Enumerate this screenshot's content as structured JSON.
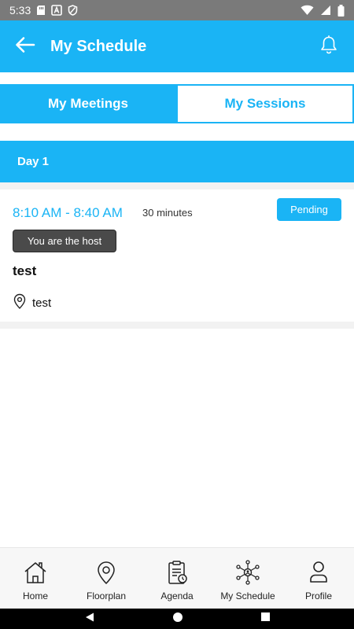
{
  "status_bar": {
    "time": "5:33",
    "icons_left": [
      "sd-card-icon",
      "a-icon",
      "shield-icon"
    ],
    "icons_right": [
      "wifi-icon",
      "signal-icon",
      "battery-icon"
    ]
  },
  "app_bar": {
    "title": "My Schedule",
    "back_icon": "arrow-left-icon",
    "notification_icon": "bell-icon"
  },
  "tabs": [
    {
      "label": "My Meetings",
      "active": true
    },
    {
      "label": "My Sessions",
      "active": false
    }
  ],
  "day": {
    "label": "Day 1"
  },
  "session": {
    "time_range": "8:10 AM - 8:40 AM",
    "duration": "30 minutes",
    "status": "Pending",
    "host_label": "You are the host",
    "title": "test",
    "location": "test"
  },
  "bottom_nav": [
    {
      "label": "Home",
      "icon": "home-icon"
    },
    {
      "label": "Floorplan",
      "icon": "map-pin-icon"
    },
    {
      "label": "Agenda",
      "icon": "clipboard-clock-icon"
    },
    {
      "label": "My Schedule",
      "icon": "network-person-icon"
    },
    {
      "label": "Profile",
      "icon": "user-icon"
    }
  ],
  "colors": {
    "accent": "#1ab4f5",
    "host_badge": "#4a4a4a",
    "status_bar": "#7a7a7a"
  }
}
